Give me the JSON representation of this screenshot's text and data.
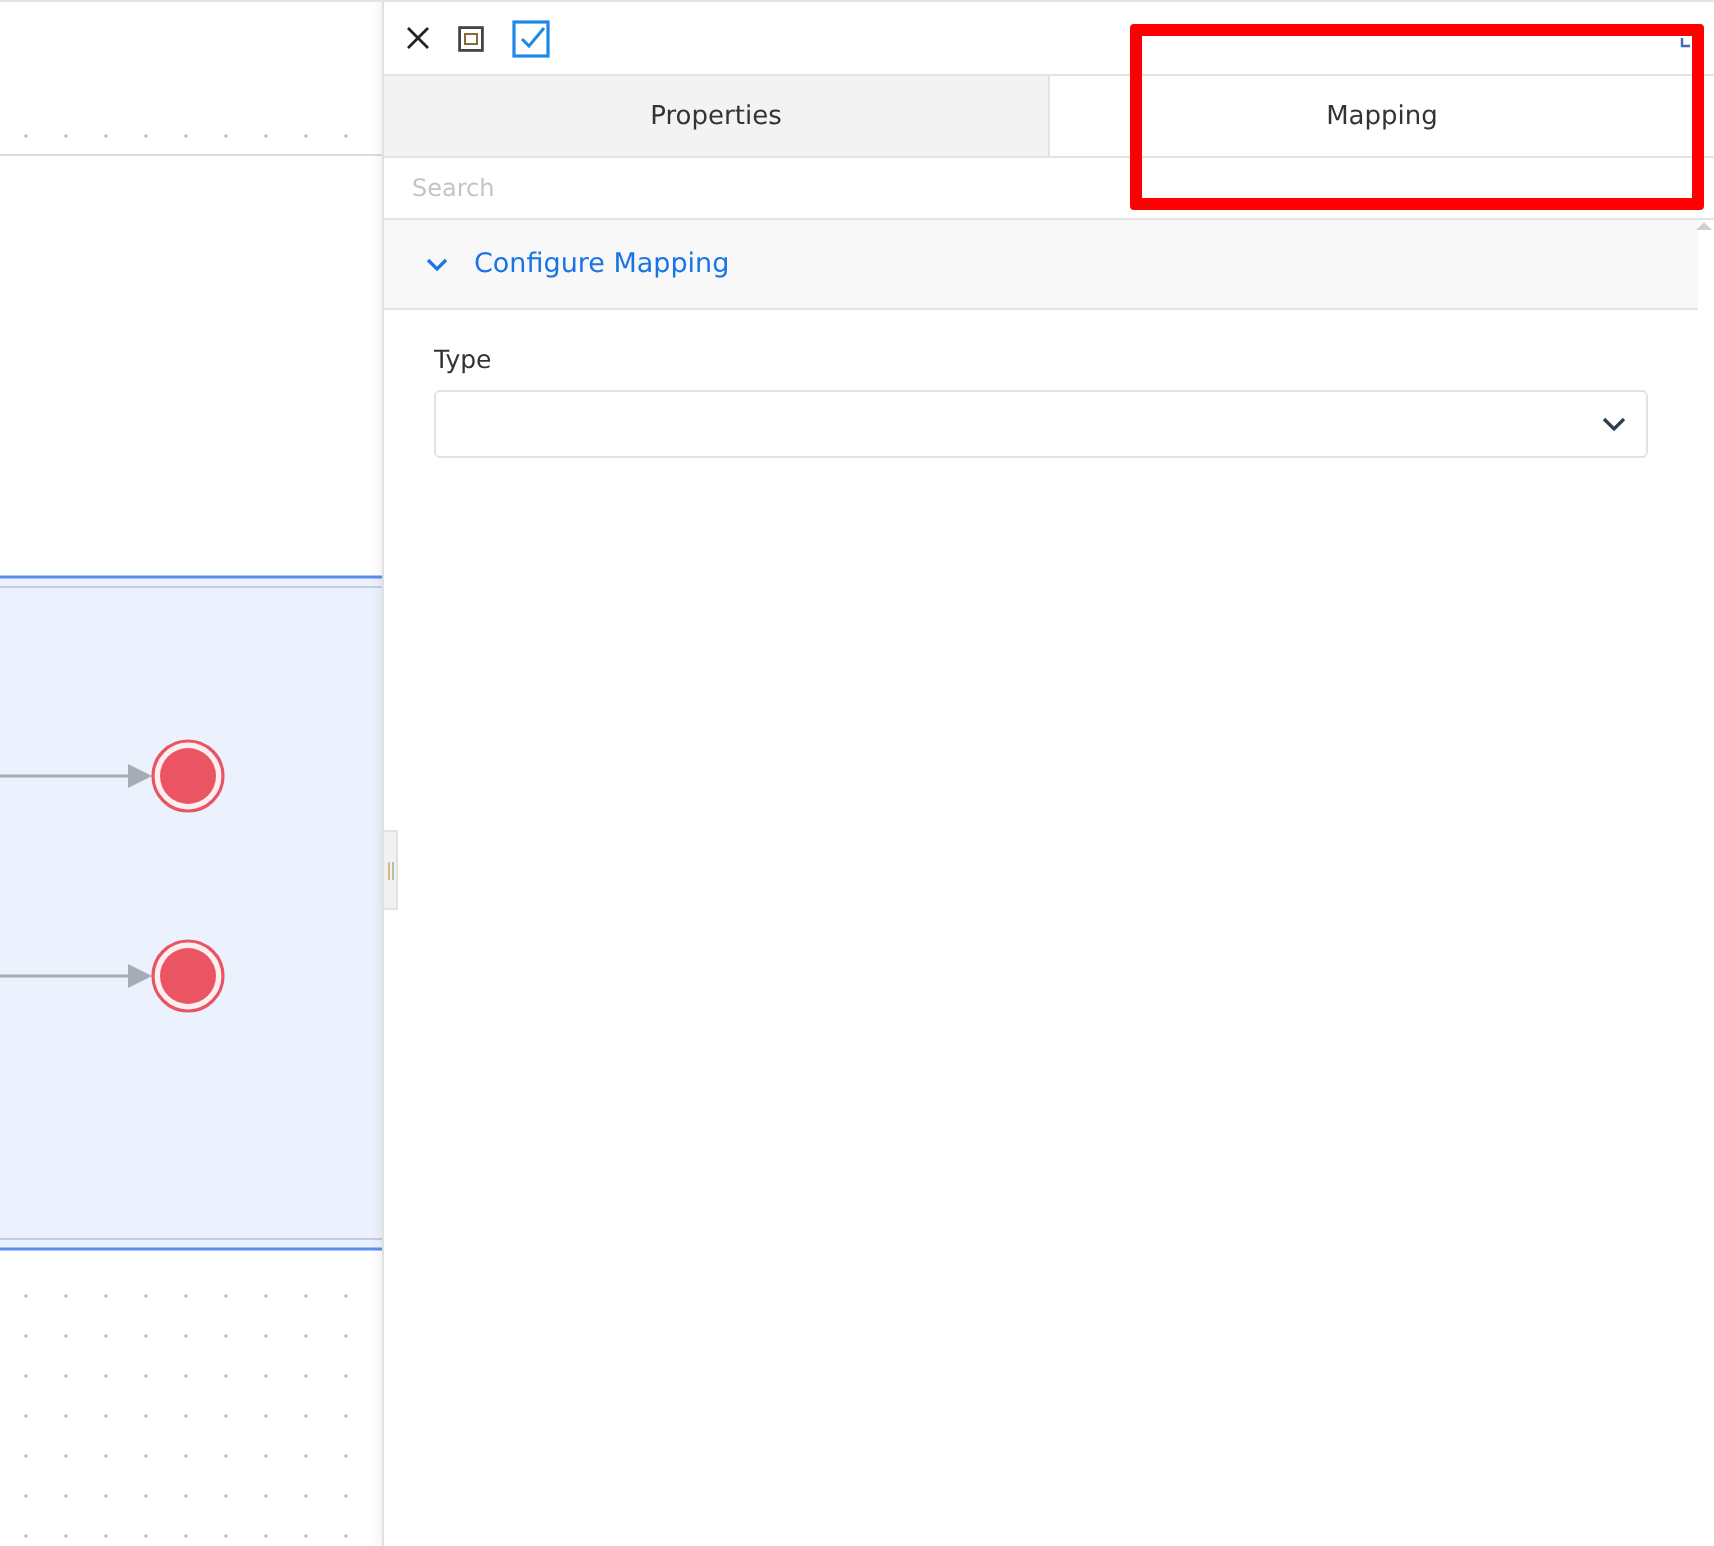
{
  "diagram": {
    "end_events": [
      {
        "kind": "end"
      },
      {
        "kind": "end"
      }
    ]
  },
  "panel": {
    "tabs": [
      {
        "label": "Properties",
        "selected": false
      },
      {
        "label": "Mapping",
        "selected": true
      }
    ],
    "search": {
      "placeholder": "Search"
    },
    "section": {
      "title": "Configure Mapping",
      "expanded": true
    },
    "fields": [
      {
        "label": "Type",
        "kind": "select"
      }
    ]
  }
}
